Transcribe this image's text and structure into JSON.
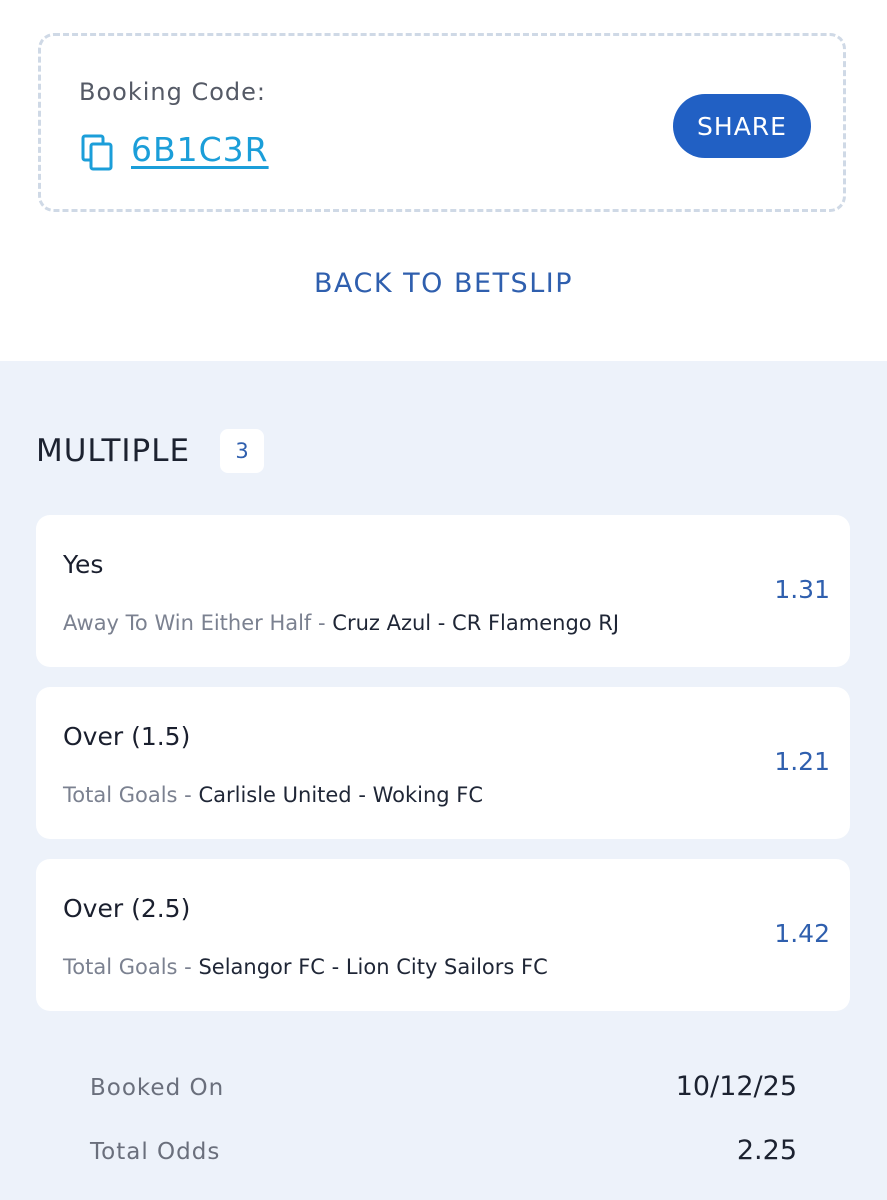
{
  "booking": {
    "label": "Booking Code:",
    "code": "6B1C3R",
    "share_label": "SHARE"
  },
  "back_link": "BACK TO BETSLIP",
  "multiple": {
    "title": "MULTIPLE",
    "count": "3"
  },
  "bets": [
    {
      "selection": "Yes",
      "market": "Away To Win Either Half",
      "separator": " - ",
      "event": "Cruz Azul - CR Flamengo RJ",
      "odds": "1.31"
    },
    {
      "selection": "Over (1.5)",
      "market": "Total Goals",
      "separator": " - ",
      "event": "Carlisle United - Woking FC",
      "odds": "1.21"
    },
    {
      "selection": "Over (2.5)",
      "market": "Total Goals",
      "separator": " - ",
      "event": "Selangor FC - Lion City Sailors FC",
      "odds": "1.42"
    }
  ],
  "summary": {
    "booked_on_label": "Booked On",
    "booked_on_value": "10/12/25",
    "total_odds_label": "Total Odds",
    "total_odds_value": "2.25"
  },
  "colors": {
    "accent": "#2160c4",
    "link": "#1b9ed9",
    "background_lower": "#edf2fa"
  }
}
